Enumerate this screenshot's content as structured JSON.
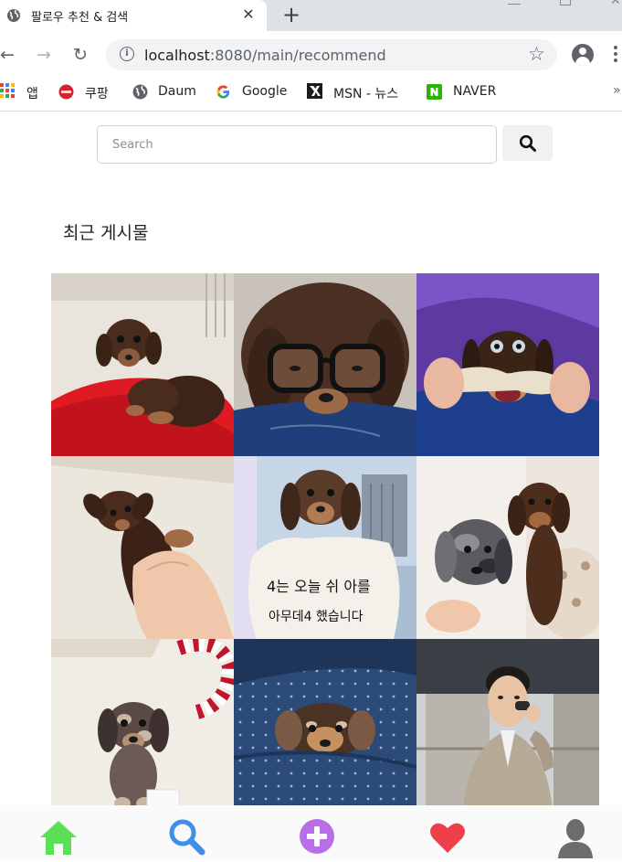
{
  "browser": {
    "tab_title": "팔로우 추천 & 검색",
    "tab_close": "✕",
    "new_tab": "+",
    "url_host": "localhost",
    "url_path": ":8080/main/recommend",
    "bookmarks": [
      {
        "label": "앱",
        "icon": "apps-grid-icon"
      },
      {
        "label": "쿠팡",
        "icon": "coupang-icon"
      },
      {
        "label": "Daum",
        "icon": "globe-icon"
      },
      {
        "label": "Google",
        "icon": "google-icon"
      },
      {
        "label": "MSN - 뉴스",
        "icon": "msn-icon"
      },
      {
        "label": "NAVER",
        "icon": "naver-icon"
      }
    ],
    "more_bookmarks": "»"
  },
  "search": {
    "placeholder": "Search",
    "button_icon": "search-icon"
  },
  "section": {
    "title": "최근 게시물"
  },
  "posts": [
    {
      "subject": "puppy on red cushion"
    },
    {
      "subject": "puppy wearing glasses"
    },
    {
      "subject": "puppy chewing toy"
    },
    {
      "subject": "puppy held by hand"
    },
    {
      "subject": "puppy with sign",
      "sign_text": [
        "4는 오늘 쉬 아를",
        "아무데4 했습니다"
      ]
    },
    {
      "subject": "two puppies"
    },
    {
      "subject": "dappled puppy with rope toy"
    },
    {
      "subject": "puppy on blanket"
    },
    {
      "subject": "man holding microphone"
    }
  ],
  "bottom_nav": [
    {
      "icon": "home-icon",
      "color": "#5be055"
    },
    {
      "icon": "search-icon",
      "color": "#3f8fe8"
    },
    {
      "icon": "add-post-icon",
      "color": "#b86ee8"
    },
    {
      "icon": "heart-icon",
      "color": "#ef3f4a"
    },
    {
      "icon": "profile-icon",
      "color": "#6c6c6c"
    }
  ]
}
